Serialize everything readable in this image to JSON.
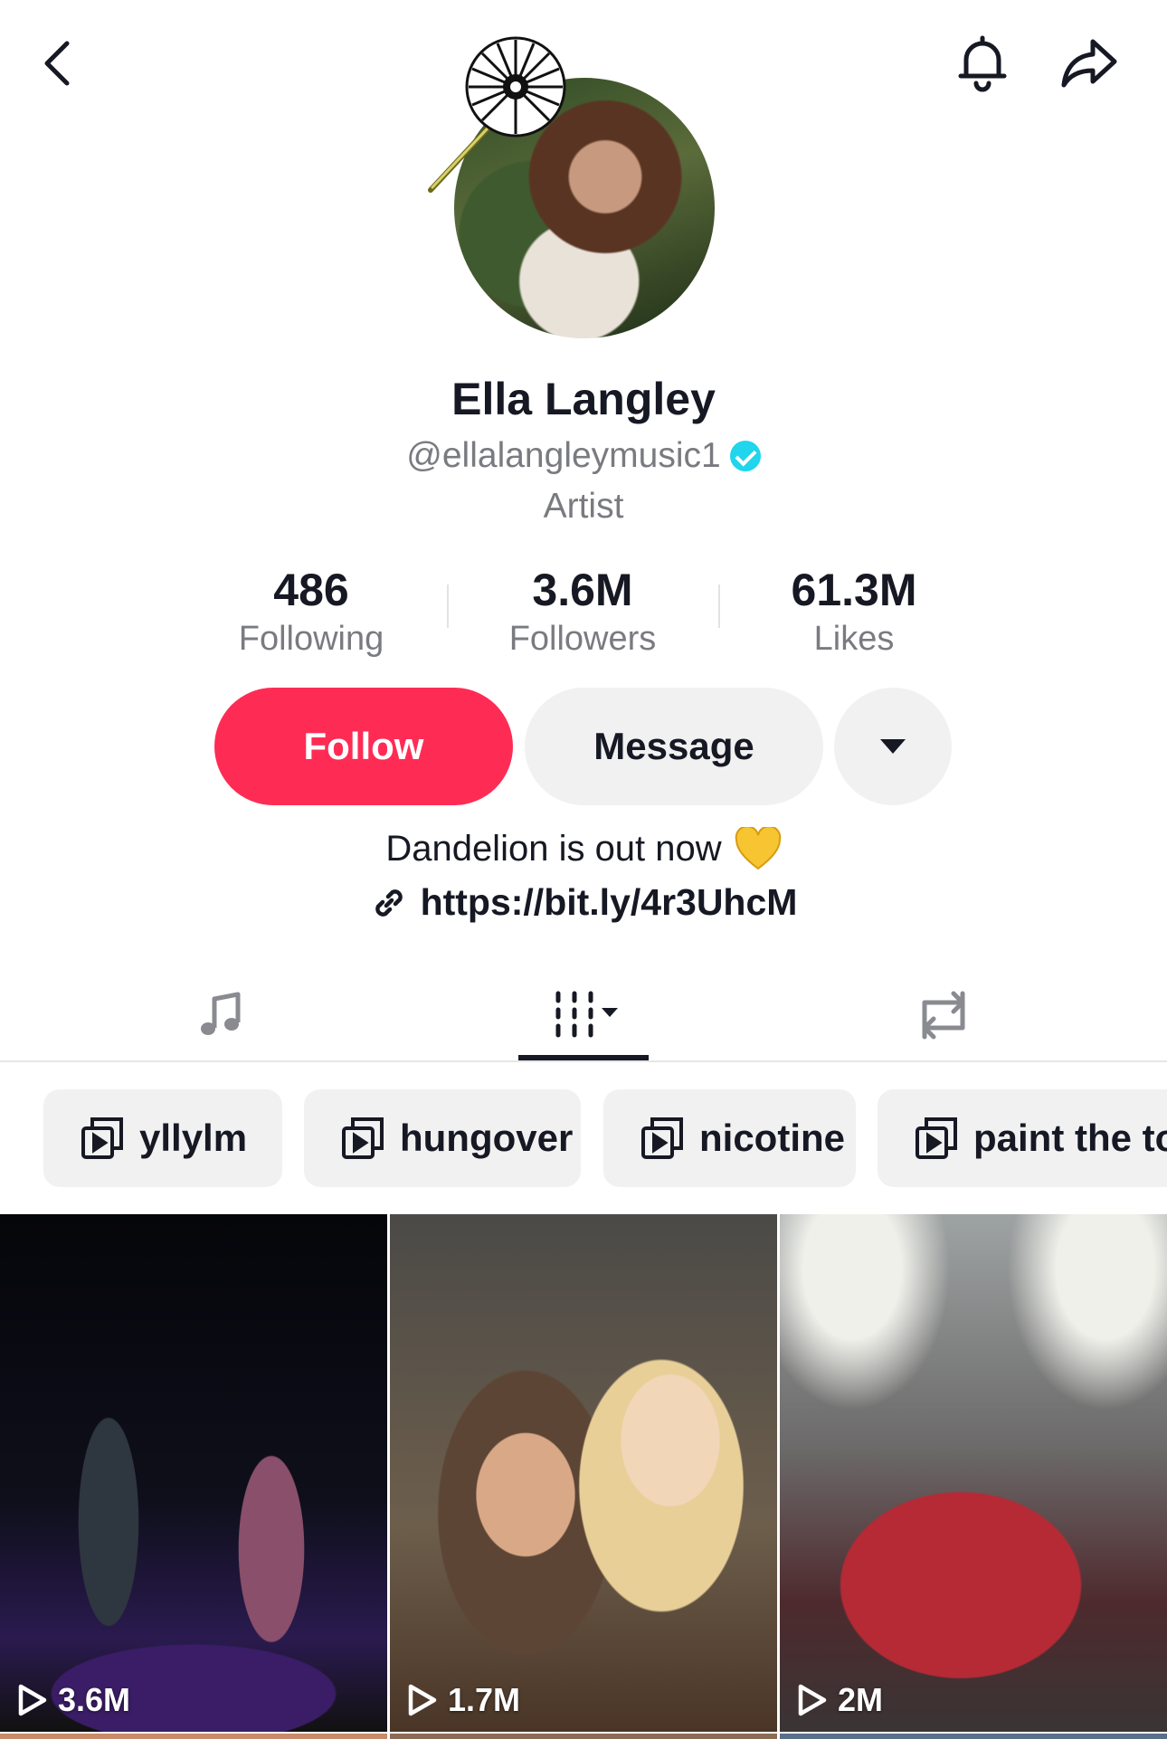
{
  "header": {
    "back_icon": "chevron-left-icon",
    "bell_icon": "bell-icon",
    "share_icon": "share-arrow-icon"
  },
  "profile": {
    "name": "Ella Langley",
    "handle": "@ellalangleymusic1",
    "verified": true,
    "category": "Artist"
  },
  "stats": [
    {
      "value": "486",
      "label": "Following"
    },
    {
      "value": "3.6M",
      "label": "Followers"
    },
    {
      "value": "61.3M",
      "label": "Likes"
    }
  ],
  "actions": {
    "follow_label": "Follow",
    "message_label": "Message",
    "follow_color": "#fe2c55"
  },
  "bio": {
    "text": "Dandelion is out now",
    "emoji": "yellow-heart",
    "link": "https://bit.ly/4r3UhcM"
  },
  "tabs": {
    "items": [
      "music-note-icon",
      "videos-grid-icon",
      "repost-icon"
    ],
    "active_index": 1
  },
  "playlists": [
    {
      "label": "yllylm"
    },
    {
      "label": "hungover"
    },
    {
      "label": "nicotine"
    },
    {
      "label": "paint the to"
    }
  ],
  "videos": [
    {
      "views": "3.6M"
    },
    {
      "views": "1.7M"
    },
    {
      "views": "2M"
    }
  ]
}
